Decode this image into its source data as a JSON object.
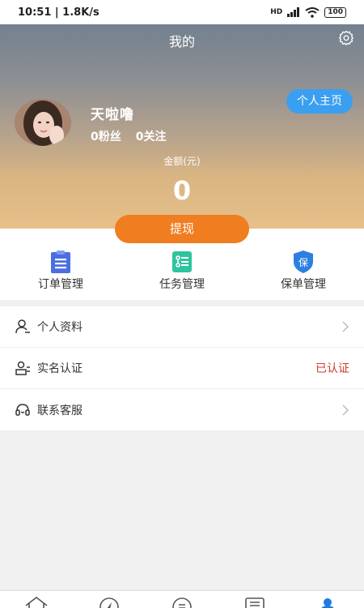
{
  "status_bar": {
    "time": "10:51 | 1.8K/s",
    "network": "HD",
    "battery": "100"
  },
  "header": {
    "title": "我的"
  },
  "user": {
    "name": "天啦噜",
    "fans": "0粉丝",
    "following": "0关注"
  },
  "profile_button": "个人主页",
  "balance": {
    "label": "金额(元)",
    "value": "0"
  },
  "withdraw_button": "提现",
  "quick_actions": [
    {
      "label": "订单管理",
      "icon": "clipboard-icon",
      "color": "#4b6fe0"
    },
    {
      "label": "任务管理",
      "icon": "task-list-icon",
      "color": "#2ec4a0"
    },
    {
      "label": "保单管理",
      "icon": "shield-insurance-icon",
      "color": "#2d7fe0",
      "icon_text": "保"
    }
  ],
  "menu": [
    {
      "label": "个人资料",
      "value": "",
      "icon": "user-icon"
    },
    {
      "label": "实名认证",
      "value": "已认证",
      "icon": "id-verify-icon"
    },
    {
      "label": "联系客服",
      "value": "",
      "icon": "headset-icon"
    }
  ],
  "tabs": [
    "home-icon",
    "compass-icon",
    "message-icon",
    "list-icon",
    "profile-icon"
  ],
  "colors": {
    "accent_blue": "#3a9ff0",
    "withdraw_orange": "#f07d1f",
    "verified_red": "#cc3b2f"
  }
}
